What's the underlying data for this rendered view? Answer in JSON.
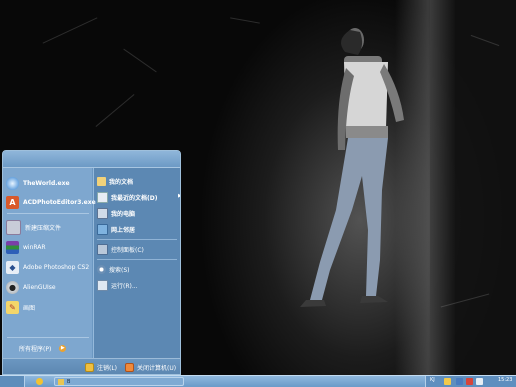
{
  "start_menu": {
    "pinned": [
      {
        "label": "TheWorld.exe",
        "icon": "world-browser-icon"
      },
      {
        "label": "ACDPhotoEditor3.exe",
        "icon": "acd-photo-editor-icon"
      }
    ],
    "recent": [
      {
        "label": "新建压缩文件",
        "icon": "archive-icon"
      },
      {
        "label": "winRAR",
        "icon": "winrar-icon"
      },
      {
        "label": "Adobe Photoshop CS2",
        "icon": "photoshop-icon"
      },
      {
        "label": "AlienGUIse",
        "icon": "alien-icon"
      },
      {
        "label": "画图",
        "icon": "paint-icon"
      }
    ],
    "all_programs": "所有程序(P)",
    "right_items": [
      {
        "label": "我的文档",
        "icon": "documents-icon"
      },
      {
        "label": "我最近的文档(D)",
        "icon": "recent-documents-icon"
      },
      {
        "label": "我的电脑",
        "icon": "computer-icon"
      },
      {
        "label": "网上邻居",
        "icon": "network-icon"
      },
      {
        "label": "控制面板(C)",
        "icon": "control-panel-icon"
      },
      {
        "label": "搜索(S)",
        "icon": "search-icon"
      },
      {
        "label": "运行(R)...",
        "icon": "run-icon"
      }
    ],
    "logoff": "注销(L)",
    "shutdown": "关闭计算机(U)"
  },
  "taskbar": {
    "task_label": "B",
    "tray_label": "KJ",
    "clock": "15:23"
  }
}
